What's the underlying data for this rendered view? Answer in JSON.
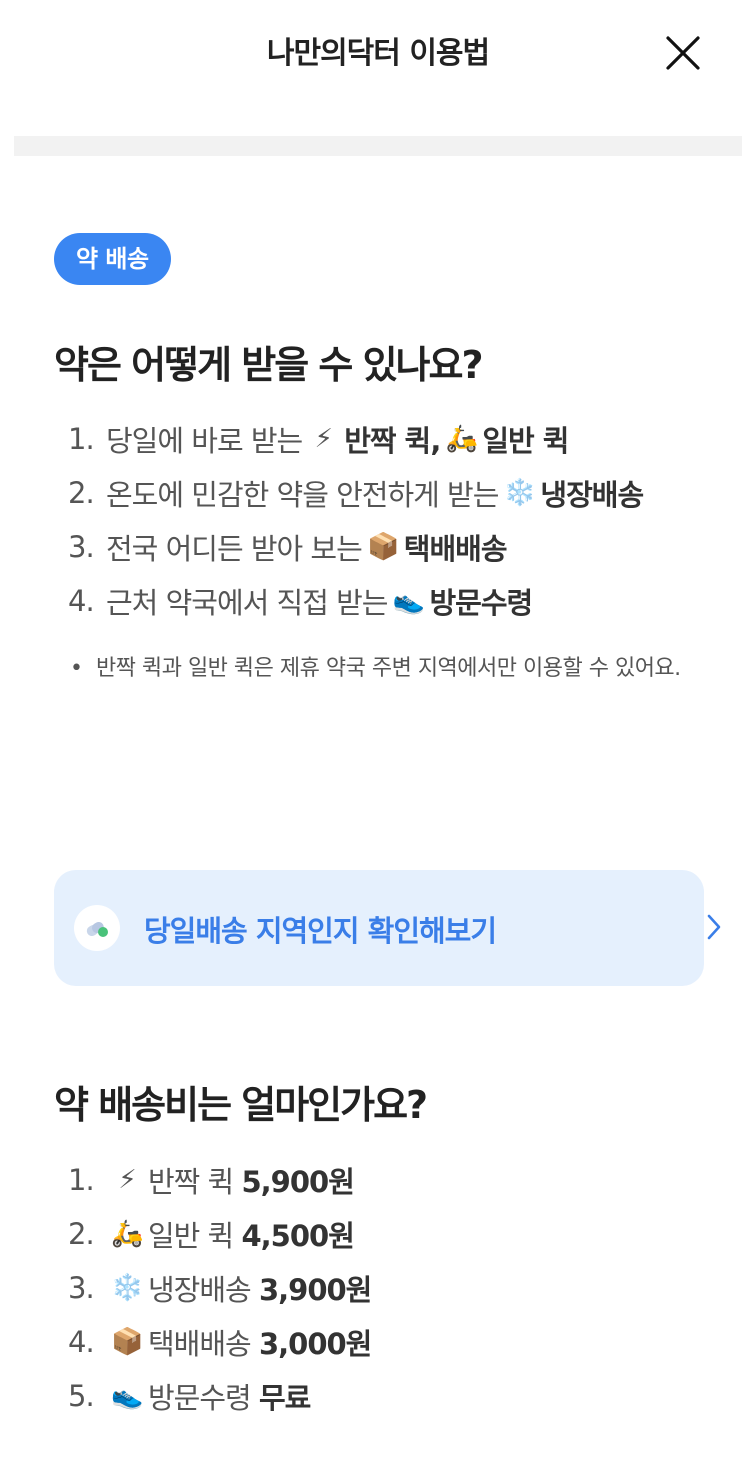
{
  "header": {
    "title": "나만의닥터 이용법"
  },
  "section_badge": "약 배송",
  "q1": {
    "title": "약은 어떻게 받을 수 있나요?",
    "items": [
      {
        "num": "1.",
        "text": "당일에 바로 받는",
        "emoji": "⚡",
        "strong": "반짝 퀵,",
        "emoji2": "🛵",
        "strong2": "일반 퀵"
      },
      {
        "num": "2.",
        "text": "온도에 민감한 약을 안전하게 받는",
        "emoji": "❄️",
        "strong": "냉장배송"
      },
      {
        "num": "3.",
        "text": "전국 어디든 받아 보는",
        "emoji": "📦",
        "strong": "택배배송"
      },
      {
        "num": "4.",
        "text": "근처 약국에서 직접 받는",
        "emoji": "👟",
        "strong": "방문수령"
      }
    ],
    "note": "반짝 퀵과 일반 퀵은 제휴 약국 주변 지역에서만 이용할 수 있어요."
  },
  "cta": {
    "label": "당일배송 지역인지 확인해보기",
    "icon": "pill-icon",
    "arrow": "chevron-right-icon"
  },
  "q2": {
    "title": "약 배송비는 얼마인가요?",
    "items": [
      {
        "num": "1.",
        "emoji": "⚡",
        "name": "반짝 퀵",
        "price": "5,900원"
      },
      {
        "num": "2.",
        "emoji": "🛵",
        "name": "일반 퀵",
        "price": "4,500원"
      },
      {
        "num": "3.",
        "emoji": "❄️",
        "name": "냉장배송",
        "price": "3,900원"
      },
      {
        "num": "4.",
        "emoji": "📦",
        "name": "택배배송",
        "price": "3,000원"
      },
      {
        "num": "5.",
        "emoji": "👟",
        "name": "방문수령",
        "price": "무료"
      }
    ]
  },
  "colors": {
    "accent": "#3a86f2",
    "cta_background": "#e5f0fd",
    "cta_text": "#3a7ee8"
  }
}
